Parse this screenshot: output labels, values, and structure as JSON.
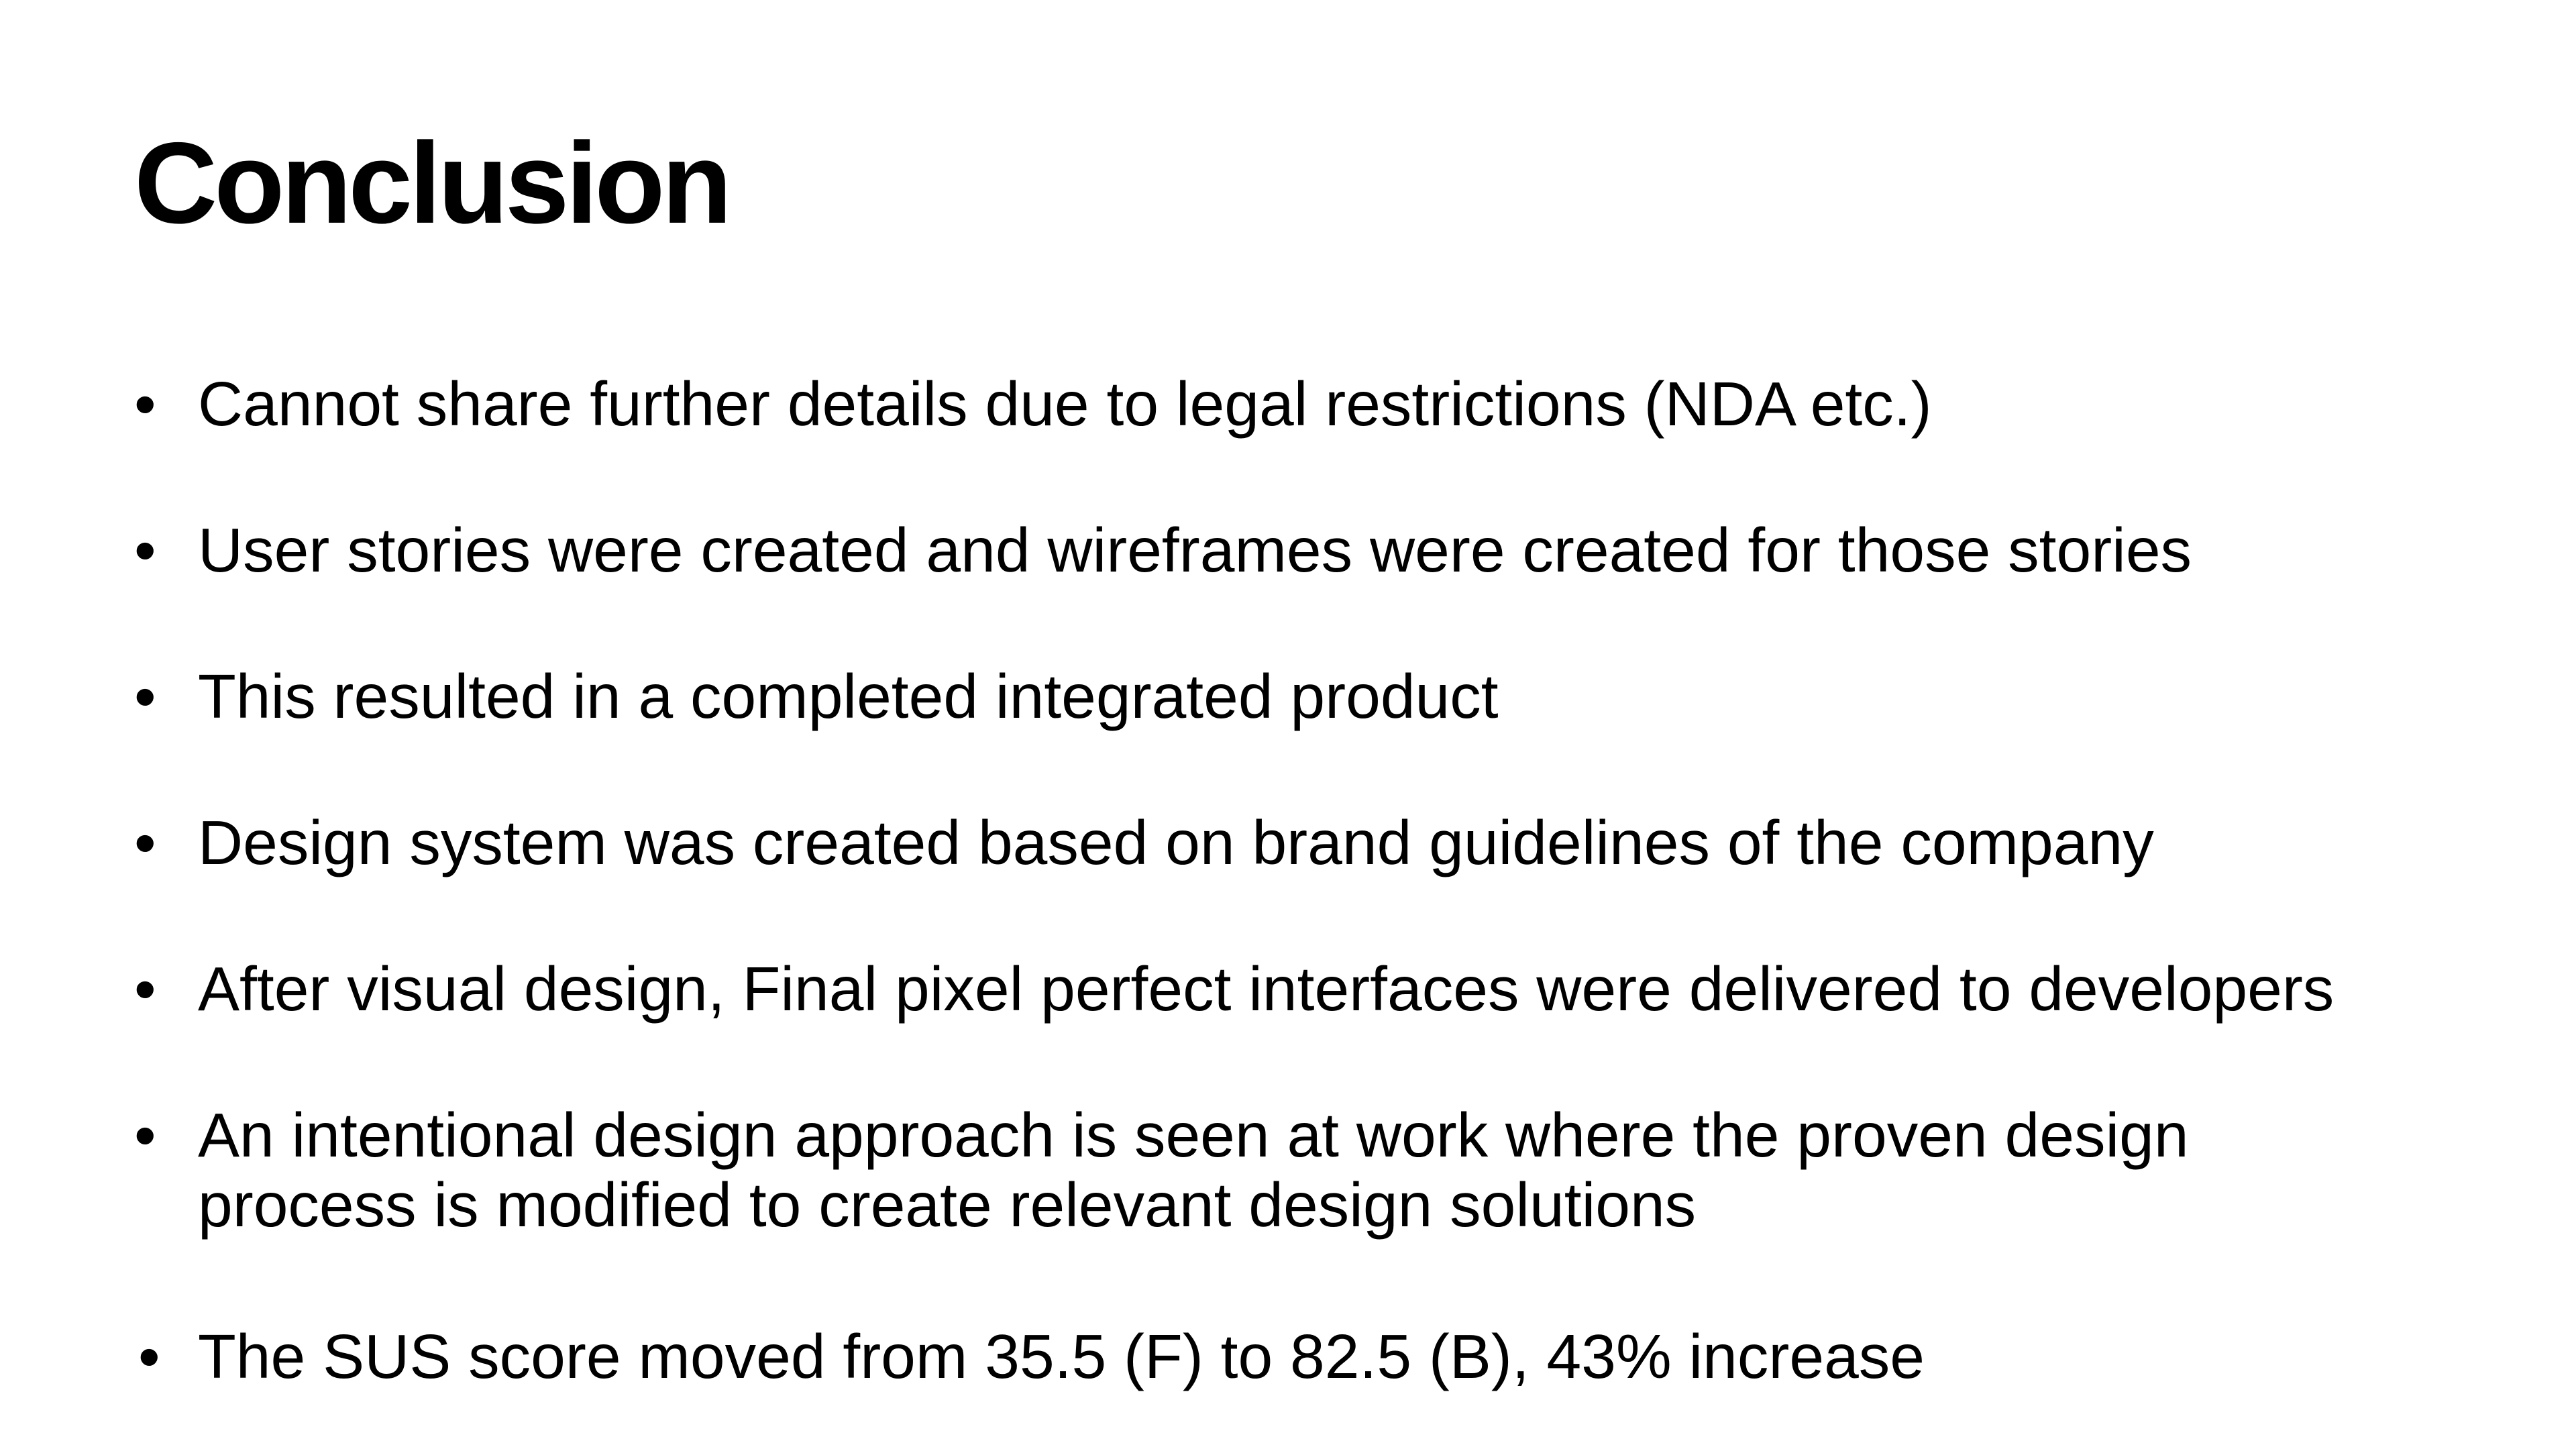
{
  "slide": {
    "title": "Conclusion",
    "bullet_glyph": "•",
    "bullets": [
      {
        "lines": [
          "Cannot share further details due to legal restrictions (NDA etc.)"
        ]
      },
      {
        "lines": [
          "User stories were created and wireframes were created for those stories"
        ]
      },
      {
        "lines": [
          "This resulted in a completed integrated product"
        ]
      },
      {
        "lines": [
          "Design system was created based on brand guidelines of the company"
        ]
      },
      {
        "lines": [
          "After visual design, Final pixel perfect interfaces were delivered to developers"
        ]
      },
      {
        "lines": [
          "An intentional design approach is seen at work where the proven design",
          "process is modified to create relevant design solutions"
        ]
      },
      {
        "lines": [
          "The SUS score moved from 35.5 (F) to 82.5 (B), 43% increase"
        ]
      }
    ]
  }
}
